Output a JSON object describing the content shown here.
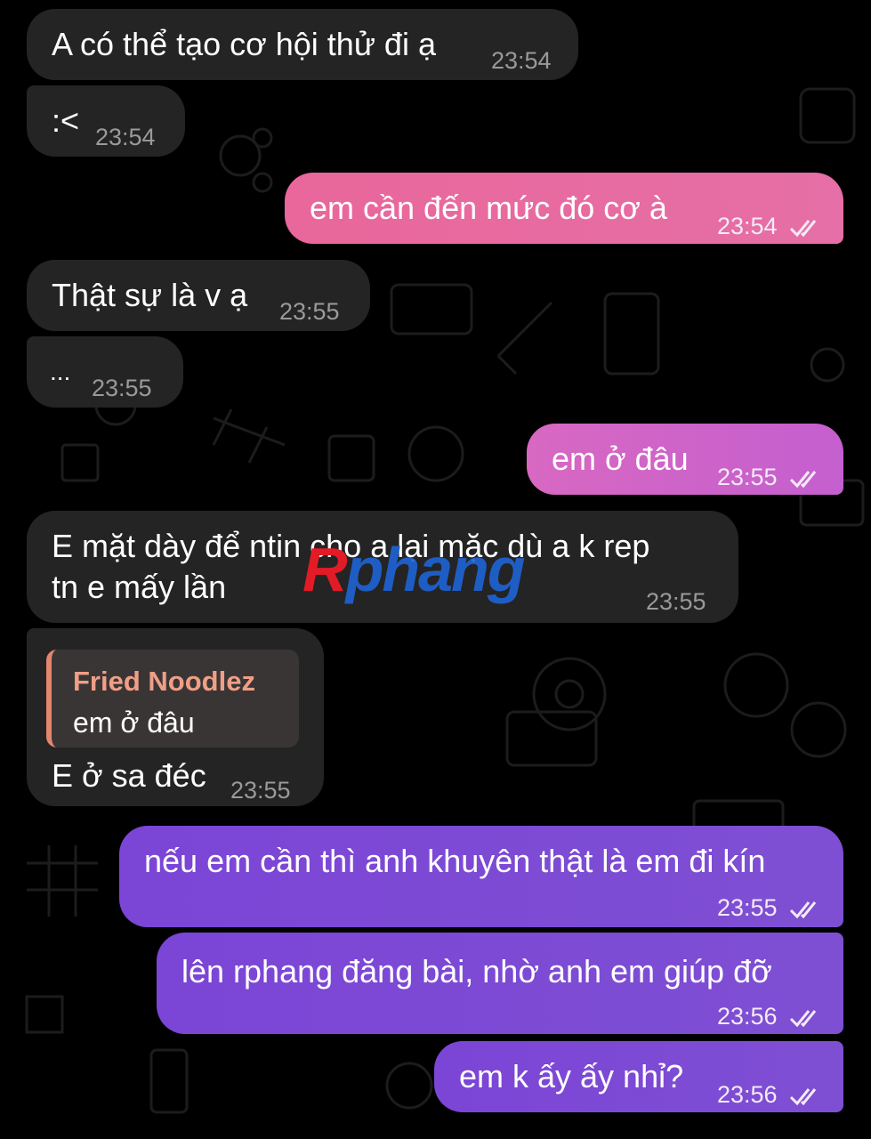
{
  "watermark": {
    "first": "R",
    "rest": "phang"
  },
  "messages": [
    {
      "text": "A có thể tạo cơ hội thử đi ạ",
      "time": "23:54"
    },
    {
      "text": ":<",
      "time": "23:54"
    },
    {
      "text": "em cần đến mức đó cơ à",
      "time": "23:54"
    },
    {
      "text": "Thật sự là v ạ",
      "time": "23:55"
    },
    {
      "text": "...",
      "time": "23:55"
    },
    {
      "text": "em ở đâu",
      "time": "23:55"
    },
    {
      "line1": "E mặt dày để ntin cho a lại mặc dù a k rep",
      "line2": "tn e mấy lần",
      "time": "23:55"
    },
    {
      "reply_name": "Fried Noodlez",
      "reply_text": "em ở đâu",
      "text": "E ở sa đéc",
      "time": "23:55"
    },
    {
      "text": "nếu em cần thì anh khuyên thật là em đi kín",
      "time": "23:55"
    },
    {
      "text": "lên rphang đăng bài, nhờ anh em giúp đỡ",
      "time": "23:56"
    },
    {
      "text": "em k ấy ấy nhỉ?",
      "time": "23:56"
    }
  ],
  "colors": {
    "incoming": "#242424",
    "outgoing_pink": "#e9679b",
    "outgoing_magenta": "#d868c2",
    "outgoing_purple": "#7b45d6",
    "reply_accent": "#e3866e"
  }
}
